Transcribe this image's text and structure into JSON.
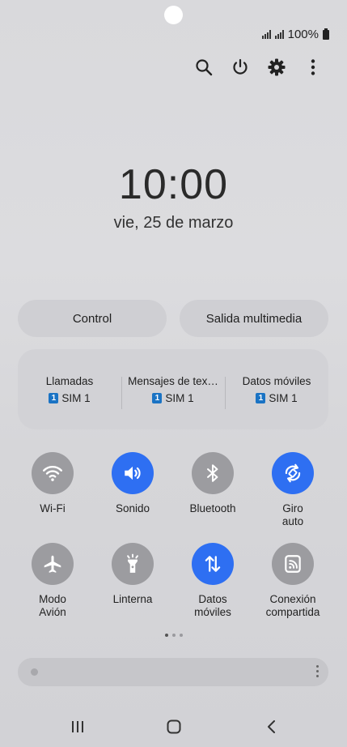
{
  "status": {
    "battery": "100%"
  },
  "clock": {
    "time": "10:00",
    "date": "vie, 25 de marzo"
  },
  "quick_buttons": {
    "control": "Control",
    "media_output": "Salida multimedia"
  },
  "sim": [
    {
      "title": "Llamadas",
      "sim": "SIM 1",
      "badge": "1"
    },
    {
      "title": "Mensajes de tex…",
      "sim": "SIM 1",
      "badge": "1"
    },
    {
      "title": "Datos móviles",
      "sim": "SIM 1",
      "badge": "1"
    }
  ],
  "tiles": [
    {
      "label": "Wi-Fi",
      "icon": "wifi-icon",
      "on": false
    },
    {
      "label": "Sonido",
      "icon": "sound-icon",
      "on": true
    },
    {
      "label": "Bluetooth",
      "icon": "bluetooth-icon",
      "on": false
    },
    {
      "label": "Giro\nauto",
      "icon": "auto-rotate-icon",
      "on": true
    },
    {
      "label": "Modo\nAvión",
      "icon": "airplane-icon",
      "on": false
    },
    {
      "label": "Linterna",
      "icon": "flashlight-icon",
      "on": false
    },
    {
      "label": "Datos\nmóviles",
      "icon": "mobile-data-icon",
      "on": true
    },
    {
      "label": "Conexión\ncompartida",
      "icon": "hotspot-icon",
      "on": false
    }
  ],
  "colors": {
    "accent": "#2e6ff2",
    "tile_off": "#9c9ca0"
  },
  "pager": {
    "count": 3,
    "active": 0
  }
}
